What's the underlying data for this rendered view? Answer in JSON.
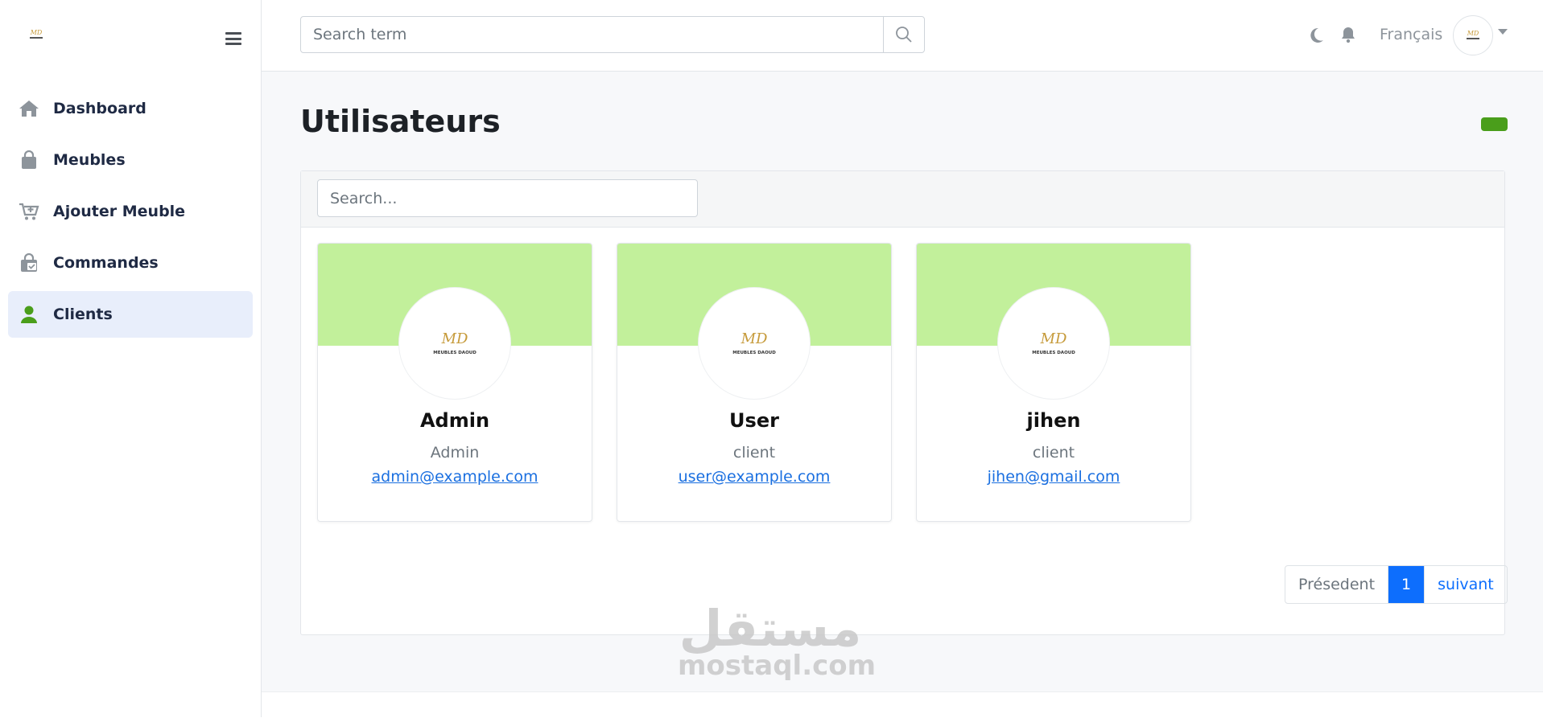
{
  "sidebar": {
    "items": [
      {
        "label": "Dashboard",
        "icon": "home-icon"
      },
      {
        "label": "Meubles",
        "icon": "shopping-bag-icon"
      },
      {
        "label": "Ajouter Meuble",
        "icon": "cart-plus-icon"
      },
      {
        "label": "Commandes",
        "icon": "shopping-bag-check-icon"
      },
      {
        "label": "Clients",
        "icon": "user-icon"
      }
    ],
    "active": "Clients"
  },
  "topbar": {
    "search_placeholder": "Search term",
    "language": "Français"
  },
  "main": {
    "title": "Utilisateurs",
    "search_placeholder": "Search...",
    "users": [
      {
        "name": "Admin",
        "role": "Admin",
        "email": "admin@example.com"
      },
      {
        "name": "User",
        "role": "client",
        "email": "user@example.com"
      },
      {
        "name": "jihen",
        "role": "client",
        "email": "jihen@gmail.com"
      }
    ],
    "pagination": {
      "prev": "Présedent",
      "current": "1",
      "next": "suivant"
    }
  },
  "logo": {
    "monogram": "MD",
    "text": "MEUBLES DAOUD"
  },
  "watermark": {
    "arabic": "مستقل",
    "latin": "mostaql.com"
  },
  "colors": {
    "accent": "#4a9e1b",
    "banner": "#c2f09b",
    "active_nav": "#e8eefb",
    "link": "#1a6fe0",
    "page_active": "#0d6efd"
  }
}
